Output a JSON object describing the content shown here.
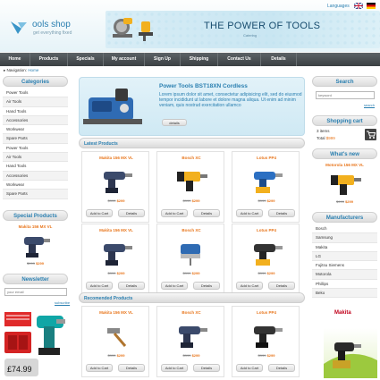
{
  "header": {
    "logo_title": "ools shop",
    "logo_sub": "get everything fixed",
    "banner_title": "THE POWER OF TOOLS",
    "banner_sub": "Catering",
    "languages_label": "Languages"
  },
  "nav": [
    "Home",
    "Products",
    "Specials",
    "My account",
    "Sign Up",
    "Shipping",
    "Contact Us",
    "Details"
  ],
  "breadcrumb": {
    "prefix": "Navigation:",
    "link": "Home"
  },
  "categories": {
    "title": "Categories",
    "items": [
      "Power Tools",
      "Air Tools",
      "Hand Tools",
      "Accessories",
      "Workwear",
      "Spare Parts",
      "Power Tools",
      "Air Tools",
      "Hand Tools",
      "Accessories",
      "Workwear",
      "Spare Parts"
    ]
  },
  "special": {
    "title": "Special Products",
    "name": "Makita 156 MX VL",
    "old": "$999",
    "new": "$299"
  },
  "newsletter": {
    "title": "Newsletter",
    "placeholder": "your email",
    "subscribe": "subscribe"
  },
  "ad": {
    "price": "£74.99",
    "brand": "Makita"
  },
  "featured": {
    "title": "Power Tools BST18XN Cordless",
    "text": "Lorem ipsum dolor sit amet, consectetur adipisicing elit, sed do eiusmod tempor incididunt ut labore et dolore magna aliqua. Ut enim ad minim veniam, quis nostrud exercitation ullamco",
    "button": "details"
  },
  "latest": {
    "title": "Latest Products",
    "cards": [
      {
        "name": "Makita 156 MX VL",
        "old": "$999",
        "new": "$299"
      },
      {
        "name": "Bosch XC",
        "old": "$999",
        "new": "$299"
      },
      {
        "name": "Lotus PP4",
        "old": "$999",
        "new": "$299"
      },
      {
        "name": "Makita 156 MX VL",
        "old": "$999",
        "new": "$299"
      },
      {
        "name": "Bosch XC",
        "old": "$999",
        "new": "$299"
      },
      {
        "name": "Lotus PP4",
        "old": "$999",
        "new": "$299"
      }
    ]
  },
  "recommended": {
    "title": "Recomended Products",
    "cards": [
      {
        "name": "Makita 156 MX VL",
        "old": "$999",
        "new": "$299"
      },
      {
        "name": "Bosch XC",
        "old": "$999",
        "new": "$299"
      },
      {
        "name": "Lotus PP4",
        "old": "$999",
        "new": "$299"
      }
    ]
  },
  "buttons": {
    "add": "Add to Cart",
    "details": "Details"
  },
  "search": {
    "title": "Search",
    "placeholder": "keyword",
    "button": "search"
  },
  "cart": {
    "title": "Shopping cart",
    "items": "3 items",
    "total_label": "Total",
    "total": "$999"
  },
  "whatsnew": {
    "title": "What's new",
    "name": "Motorola 156 MX VL",
    "old": "$999",
    "new": "$299"
  },
  "manufacturers": {
    "title": "Manufacturers",
    "items": [
      "Bosch",
      "Samsung",
      "Makita",
      "LG",
      "Fujitsu Siemens",
      "Motorola",
      "Phillips",
      "Beko"
    ]
  },
  "colors": {
    "accent": "#2a7fb0",
    "price": "#e8761c",
    "nav": "#4a4f52"
  }
}
